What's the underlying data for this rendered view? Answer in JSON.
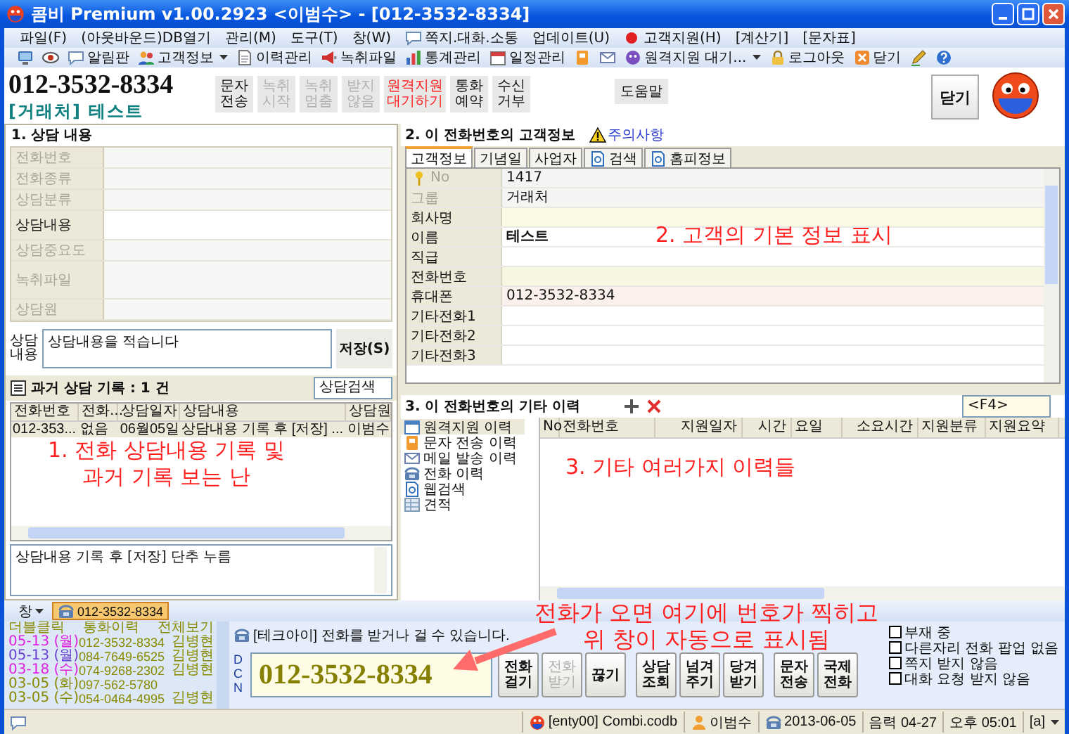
{
  "window": {
    "title": "콤비 Premium v1.00.2923 <이범수> - [012-3532-8334]"
  },
  "menu": [
    {
      "label": "파일(F)"
    },
    {
      "label": "(아웃바운드)DB열기"
    },
    {
      "label": "관리(M)"
    },
    {
      "label": "도구(T)"
    },
    {
      "label": "창(W)"
    },
    {
      "label": "쪽지.대화.소통"
    },
    {
      "label": "업데이트(U)"
    },
    {
      "label": "고객지원(H)"
    },
    {
      "label": "[계산기]"
    },
    {
      "label": "[문자표]"
    }
  ],
  "toolbar": [
    {
      "dropdown": false
    },
    {
      "dropdown": false
    },
    {
      "label": "알림판",
      "dropdown": false
    },
    {
      "label": "고객정보",
      "dropdown": true
    },
    {
      "label": "이력관리",
      "dropdown": false
    },
    {
      "label": "녹취파일",
      "dropdown": false
    },
    {
      "label": "통계관리",
      "dropdown": false
    },
    {
      "label": "일정관리",
      "dropdown": false
    },
    {
      "dropdown": false
    },
    {
      "dropdown": false
    },
    {
      "label": "원격지원 대기...",
      "dropdown": true
    },
    {
      "label": "로그아웃",
      "dropdown": false
    },
    {
      "label": "닫기",
      "dropdown": false
    },
    {
      "dropdown": false
    },
    {
      "dropdown": false
    }
  ],
  "header": {
    "phone": "012-3532-8334",
    "customer": "[거래처] 테스트",
    "actions": [
      {
        "lines": [
          "문자",
          "전송"
        ],
        "disabled": false,
        "kind": "normal"
      },
      {
        "lines": [
          "녹취",
          "시작"
        ],
        "disabled": true,
        "kind": "normal"
      },
      {
        "lines": [
          "녹취",
          "멈춤"
        ],
        "disabled": true,
        "kind": "normal"
      },
      {
        "lines": [
          "받지",
          "않음"
        ],
        "disabled": true,
        "kind": "normal"
      },
      {
        "lines": [
          "원격지원",
          "대기하기"
        ],
        "disabled": false,
        "kind": "alert"
      },
      {
        "lines": [
          "통화",
          "예약"
        ],
        "disabled": false,
        "kind": "normal"
      },
      {
        "lines": [
          "수신",
          "거부"
        ],
        "disabled": false,
        "kind": "normal"
      }
    ],
    "help": "도움말",
    "close": "닫기"
  },
  "consult": {
    "title": "1. 상담 내용",
    "fields": [
      {
        "label": "전화번호",
        "disabled": true,
        "kind": "short"
      },
      {
        "label": "전화종류",
        "disabled": true,
        "kind": "short"
      },
      {
        "label": "상담분류",
        "disabled": true,
        "kind": "short"
      },
      {
        "label": "상담내용",
        "disabled": false,
        "kind": "medium"
      },
      {
        "label": "상담중요도",
        "disabled": true,
        "kind": "short"
      },
      {
        "label": "녹취파일",
        "disabled": true,
        "kind": "tall"
      },
      {
        "label": "상담원",
        "disabled": true,
        "kind": "short"
      }
    ],
    "memo": {
      "label_lines": [
        "상담",
        "내용"
      ],
      "value": "상담내용을 적습니다",
      "save": "저장(S)"
    }
  },
  "past": {
    "title": "과거 상담 기록 : 1 건",
    "search": "상담검색",
    "columns": [
      "전화번호",
      "전화...",
      "상담일자",
      "상담내용",
      "상담원"
    ],
    "rows": [
      {
        "cells": [
          "012-353...",
          "없음",
          "06월05일",
          "상담내용 기록 후 [저장] ...",
          "이범수"
        ],
        "selected": true
      }
    ],
    "note": "상담내용 기록 후 [저장] 단추 누름"
  },
  "customer": {
    "title": "2. 이 전화번호의 고객정보",
    "warning": "주의사항",
    "tabs": [
      {
        "label": "고객정보",
        "selected": true
      },
      {
        "label": "기념일",
        "selected": false
      },
      {
        "label": "사업자",
        "selected": false
      },
      {
        "label": "검색",
        "selected": false
      },
      {
        "label": "홈피정보",
        "selected": false
      }
    ],
    "rows": [
      {
        "label": "No",
        "value": {
          "text": "1417",
          "bold": false
        },
        "disabled": true,
        "color": "#f4f4f2"
      },
      {
        "label": "그룹",
        "value": {
          "text": "거래처",
          "bold": false
        },
        "disabled": true,
        "color": "#f4f4f2"
      },
      {
        "label": "회사명",
        "disabled": false,
        "color": "#fbf8e3"
      },
      {
        "label": "이름",
        "value": {
          "text": "테스트",
          "bold": true
        },
        "disabled": false,
        "color": "#ffffff"
      },
      {
        "label": "직급",
        "disabled": false,
        "color": "#ffffff"
      },
      {
        "label": "전화번호",
        "disabled": false,
        "color": "#f6f6e2"
      },
      {
        "label": "휴대폰",
        "value": {
          "text": "012-3532-8334",
          "bold": false
        },
        "disabled": false,
        "color": "#fcf0ec"
      },
      {
        "label": "기타전화1",
        "disabled": false,
        "color": "#ffffff"
      },
      {
        "label": "기타전화2",
        "disabled": false,
        "color": "#ffffff"
      },
      {
        "label": "기타전화3",
        "disabled": false,
        "color": "#ffffff"
      }
    ]
  },
  "other": {
    "title": "3. 이 전화번호의 기타 이력",
    "search": "<F4>",
    "tree": [
      {
        "label": "원격지원 이력",
        "selected": true
      },
      {
        "label": "문자 전송 이력",
        "selected": false
      },
      {
        "label": "메일 발송 이력",
        "selected": false
      },
      {
        "label": "전화 이력",
        "selected": false
      },
      {
        "label": "웹검색",
        "selected": false
      },
      {
        "label": "견적",
        "selected": false
      }
    ],
    "columns": [
      "No",
      "전화번호",
      "지원일자",
      "시간",
      "요일",
      "소요시간",
      "지원분류",
      "지원요약"
    ]
  },
  "annotations": [
    {
      "lines": [
        "1. 전화 상담내용 기록 및",
        "과거 기록 보는 난"
      ]
    },
    {
      "lines": [
        "2. 고객의 기본 정보 표시"
      ]
    },
    {
      "lines": [
        "3. 기타 여러가지 이력들"
      ]
    },
    {
      "lines": [
        "전화가 오면 여기에 번호가 찍히고",
        "위 창이 자동으로 표시됨"
      ]
    }
  ],
  "window_tabs": {
    "menu": "창",
    "tabs": [
      {
        "label": "012-3532-8334",
        "selected": true
      }
    ]
  },
  "call": {
    "history": {
      "columns": [
        "더블클릭",
        "통화이력",
        "전체보기"
      ],
      "rows": [
        {
          "date": "05-13 (월)",
          "phone": "012-3532-8334",
          "name": "김병현",
          "color": "#e020e0"
        },
        {
          "date": "05-13 (월)",
          "phone": "084-7649-6525",
          "name": "김병현",
          "color": "#6a40d0"
        },
        {
          "date": "03-18 (수)",
          "phone": "074-9268-2302",
          "name": "김병현",
          "color": "#e020e0"
        },
        {
          "date": "03-05 (화)",
          "phone": "097-562-5780",
          "color": "#8a8a00"
        },
        {
          "date": "03-05 (수)",
          "phone": "054-0464-4995",
          "name": "김병현",
          "color": "#8a8a00"
        }
      ]
    },
    "message": "[테크아이] 전화를 받거나 걸 수 있습니다.",
    "line_letters": [
      "D",
      "C",
      "N"
    ],
    "number": "012-3532-8334",
    "button_groups": [
      [
        {
          "lines": [
            "전화",
            "걸기"
          ],
          "disabled": false
        },
        {
          "lines": [
            "전화",
            "받기"
          ],
          "disabled": true
        },
        {
          "lines": [
            "끊기"
          ],
          "disabled": false
        }
      ],
      [
        {
          "lines": [
            "상담",
            "조회"
          ],
          "disabled": false
        },
        {
          "lines": [
            "넘겨",
            "주기"
          ],
          "disabled": false
        },
        {
          "lines": [
            "당겨",
            "받기"
          ],
          "disabled": false
        }
      ],
      [
        {
          "lines": [
            "문자",
            "전송"
          ],
          "disabled": false
        },
        {
          "lines": [
            "국제",
            "전화"
          ],
          "disabled": false
        }
      ]
    ],
    "options": [
      {
        "label": "부재 중",
        "checked": false
      },
      {
        "label": "다른자리 전화 팝업 없음",
        "checked": false
      },
      {
        "label": "쪽지 받지 않음",
        "checked": false
      },
      {
        "label": "대화 요청 받지 않음",
        "checked": false
      }
    ]
  },
  "status": {
    "items": [
      {
        "text": "[enty00] Combi.codb",
        "dropdown": false
      },
      {
        "text": "이범수",
        "dropdown": false
      },
      {
        "text": "2013-06-05",
        "dropdown": false
      },
      {
        "text": "음력 04-27",
        "dropdown": false
      },
      {
        "text": "오후 05:01",
        "dropdown": false
      },
      {
        "text": "[a]",
        "dropdown": true
      }
    ]
  }
}
